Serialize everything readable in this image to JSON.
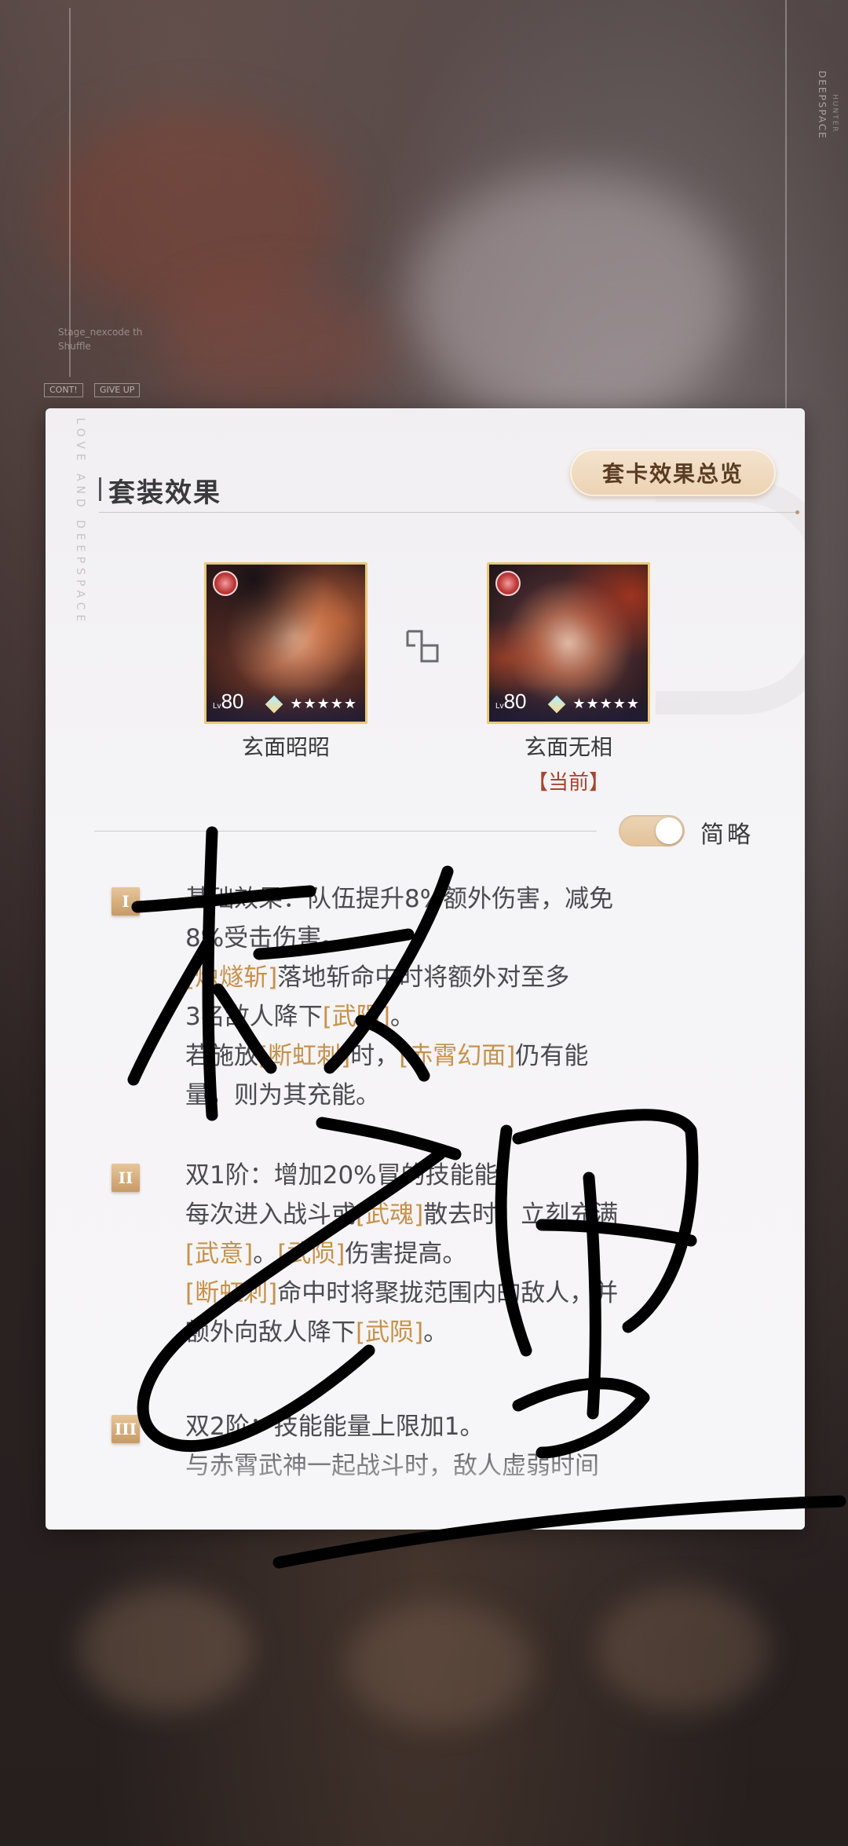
{
  "background": {
    "side_text": "DEEPSPACE",
    "side_subtext": "HUNTER",
    "small_caption": "Stage_nexcode th",
    "small_caption_2": "Shuffle",
    "btn_left": "CONT!",
    "btn_right": "GIVE UP"
  },
  "panel": {
    "side_text": "LOVE AND DEEPSPACE",
    "title": "套装效果",
    "overview_button": "套卡效果总览",
    "cards": [
      {
        "name": "玄面昭昭",
        "level": "80",
        "stars": "★★★★★",
        "current": ""
      },
      {
        "name": "玄面无相",
        "level": "80",
        "stars": "★★★★★",
        "current": "【当前】"
      }
    ],
    "toggle_label": "简略",
    "toggle_on": true
  },
  "effects": [
    {
      "tier": "I",
      "lines": [
        [
          {
            "t": "基础效果：队伍提升8%额外伤害，减免"
          }
        ],
        [
          {
            "t": "8%受击伤害。"
          }
        ],
        [
          {
            "t": "[烛燧斩]",
            "h": true
          },
          {
            "t": "落地斩命中时将额外对至多"
          }
        ],
        [
          {
            "t": "3名敌人降下"
          },
          {
            "t": "[武陨]",
            "h": true
          },
          {
            "t": "。"
          }
        ],
        [
          {
            "t": "若施放"
          },
          {
            "t": "[断虹刺]",
            "h": true
          },
          {
            "t": "时，"
          },
          {
            "t": "[赤霄幻面]",
            "h": true
          },
          {
            "t": "仍有能"
          }
        ],
        [
          {
            "t": "量，则为其充能。"
          }
        ]
      ]
    },
    {
      "tier": "II",
      "lines": [
        [
          {
            "t": "双1阶：增加20%冒的技能能。"
          }
        ],
        [
          {
            "t": "每次进入战斗或"
          },
          {
            "t": "[武魂]",
            "h": true
          },
          {
            "t": "散去时，立刻充满"
          }
        ],
        [
          {
            "t": "[武意]",
            "h": true
          },
          {
            "t": "。"
          },
          {
            "t": "[武陨]",
            "h": true
          },
          {
            "t": "伤害提高。"
          }
        ],
        [
          {
            "t": "[断虹刺]",
            "h": true
          },
          {
            "t": "命中时将聚拢范围内的敌人，并"
          }
        ],
        [
          {
            "t": "额外向敌人降下"
          },
          {
            "t": "[武陨]",
            "h": true
          },
          {
            "t": "。"
          }
        ]
      ]
    },
    {
      "tier": "III",
      "lines": [
        [
          {
            "t": "双2阶：技能能量上限加1。"
          }
        ],
        [
          {
            "t": "与赤霄武神一起战斗时，敌人虚弱时间"
          }
        ]
      ]
    }
  ],
  "colors": {
    "accent_gold": "#c7914c",
    "current_red": "#a6452f",
    "signature_ink": "#000000"
  }
}
